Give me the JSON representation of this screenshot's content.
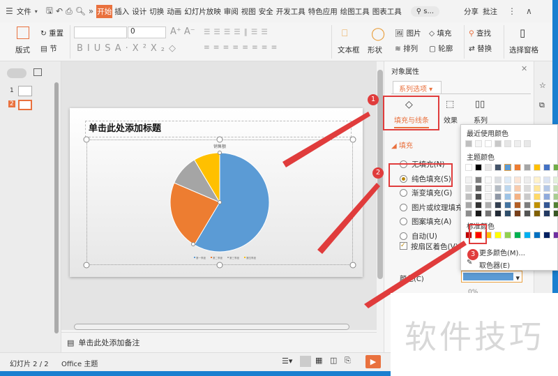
{
  "topbar": {
    "file_menu": "文件",
    "tabs": [
      "开始",
      "插入",
      "设计",
      "切换",
      "动画",
      "幻灯片放映",
      "审阅",
      "视图",
      "安全",
      "开发工具",
      "特色应用",
      "绘图工具",
      "图表工具"
    ],
    "active_tab": "开始",
    "search_placeholder": "s...",
    "share": "分享",
    "comment": "批注"
  },
  "ribbon": {
    "layout": "版式",
    "reset": "重置",
    "section": "节",
    "font_size": "0",
    "textbox": "文本框",
    "shape": "形状",
    "picture": "图片",
    "fill": "填充",
    "arrange": "排列",
    "outline": "轮廓",
    "find": "查找",
    "replace": "替换",
    "select_pane": "选择窗格"
  },
  "thumbnails": [
    {
      "num": "1"
    },
    {
      "num": "2",
      "selected": true
    }
  ],
  "slide": {
    "title_placeholder": "单击此处添加标题"
  },
  "chart_data": {
    "type": "pie",
    "title": "销售额",
    "categories": [
      "第一季度",
      "第二季度",
      "第三季度",
      "第四季度"
    ],
    "values": [
      8.2,
      3.2,
      1.4,
      1.2
    ],
    "colors": [
      "#5b9bd5",
      "#ed7d31",
      "#a5a5a5",
      "#ffc000"
    ],
    "legend": "bottom"
  },
  "notes": {
    "placeholder": "单击此处添加备注"
  },
  "status": {
    "slide_counter": "幻灯片 2 / 2",
    "theme": "Office 主题"
  },
  "pane": {
    "title": "对象属性",
    "series_dropdown": "系列选项",
    "tabs": [
      "填充与线条",
      "效果",
      "系列"
    ],
    "section": "填充",
    "fill_options": [
      "无填充(N)",
      "纯色填充(S)",
      "渐变填充(G)",
      "图片或纹理填充(",
      "图案填充(A)",
      "自动(U)"
    ],
    "selected_fill": "纯色填充(S)",
    "vary_colors": "按扇区着色(V)",
    "color_label": "颜色(C)",
    "transparency": "0%",
    "current_color": "#5b9bd5"
  },
  "palette": {
    "recent_label": "最近使用颜色",
    "theme_label": "主题颜色",
    "standard_label": "标准颜色",
    "more_colors": "更多颜色(M)...",
    "eyedropper": "取色器(E)",
    "recent": [
      "#bfbfbf",
      "#f5f5f5",
      "#ffffff",
      "#c8c8c8",
      "#e6e6e6",
      "#eeeeee",
      "#e8e8e8"
    ],
    "theme": [
      "#ffffff",
      "#000000",
      "#e7e6e6",
      "#44546a",
      "#5b9bd5",
      "#ed7d31",
      "#a5a5a5",
      "#ffc000",
      "#4472c4",
      "#70ad47"
    ],
    "standard": [
      "#c00000",
      "#ff0000",
      "#ffc000",
      "#ffff00",
      "#92d050",
      "#00b050",
      "#00b0f0",
      "#0070c0",
      "#002060",
      "#7030a0"
    ],
    "selected_standard": "#ff0000"
  },
  "annotations": {
    "steps": [
      "1",
      "2",
      "3"
    ],
    "accent": "#e03c3c"
  },
  "watermark": "软件技巧"
}
